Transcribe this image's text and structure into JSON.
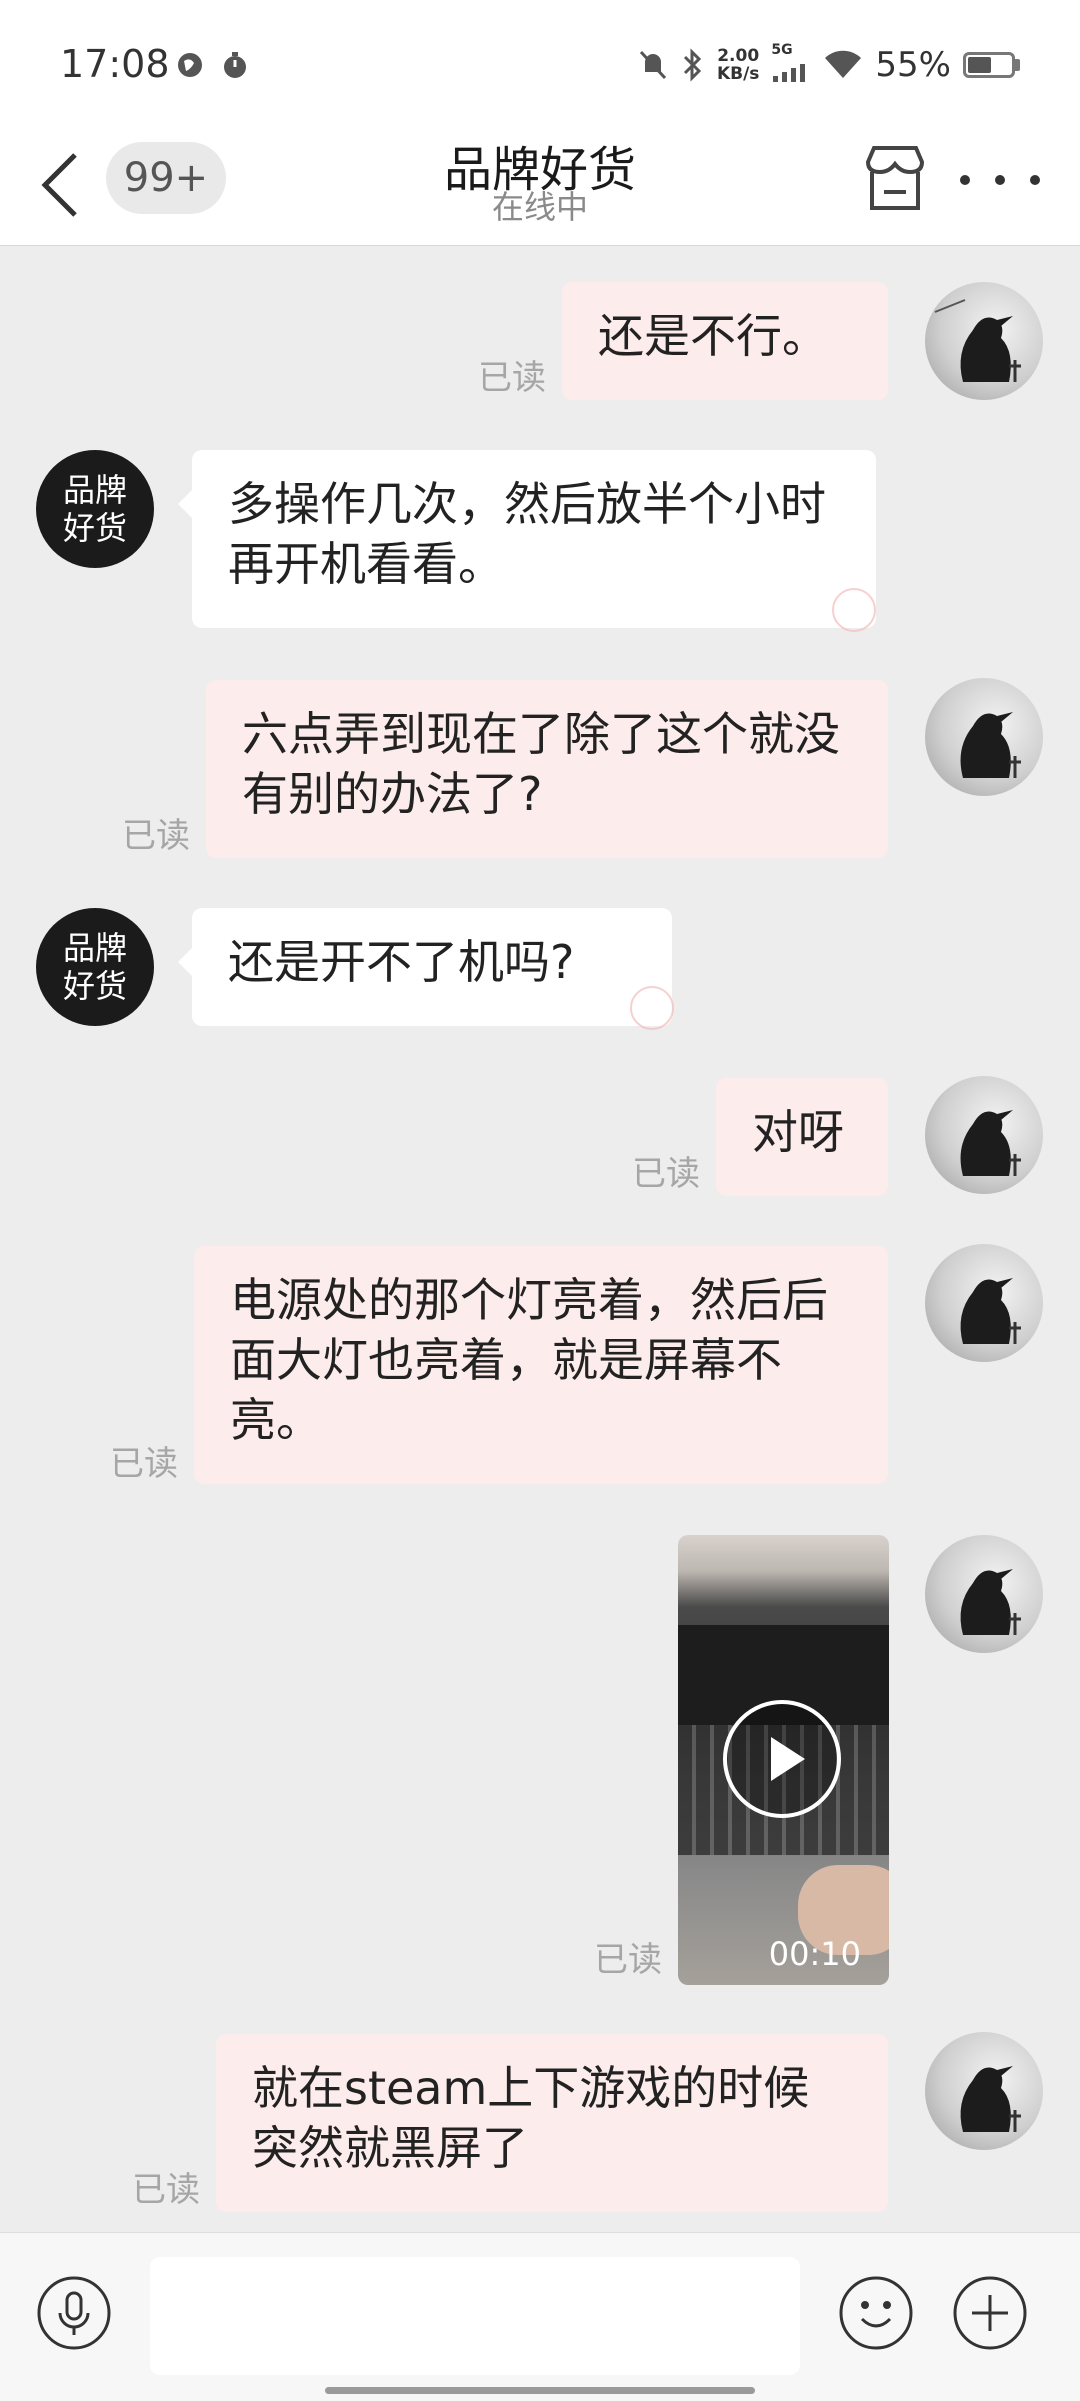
{
  "status_bar": {
    "time": "17:08",
    "net_speed_value": "2.00",
    "net_speed_unit": "KB/s",
    "network": "5G",
    "battery": "55%",
    "battery_level": 0.55
  },
  "header": {
    "title": "品牌好货",
    "subtitle": "在线中",
    "unread_badge": "99+"
  },
  "chat": {
    "shop_avatar_text": "品牌好货",
    "read_label": "已读",
    "messages": [
      {
        "text": "还是不行。"
      },
      {
        "text": "多操作几次，然后放半个小时再开机看看。"
      },
      {
        "text": "六点弄到现在了除了这个就没有别的办法了?"
      },
      {
        "text": "还是开不了机吗?"
      },
      {
        "text": "对呀"
      },
      {
        "text": "电源处的那个灯亮着，然后后面大灯也亮着，就是屏幕不亮。"
      },
      {
        "video_duration": "00:10"
      },
      {
        "text": "就在steam上下游戏的时候突然就黑屏了"
      }
    ]
  },
  "colors": {
    "outgoing_bubble": "#fdecec",
    "incoming_bubble": "#ffffff",
    "background": "#ededed"
  }
}
